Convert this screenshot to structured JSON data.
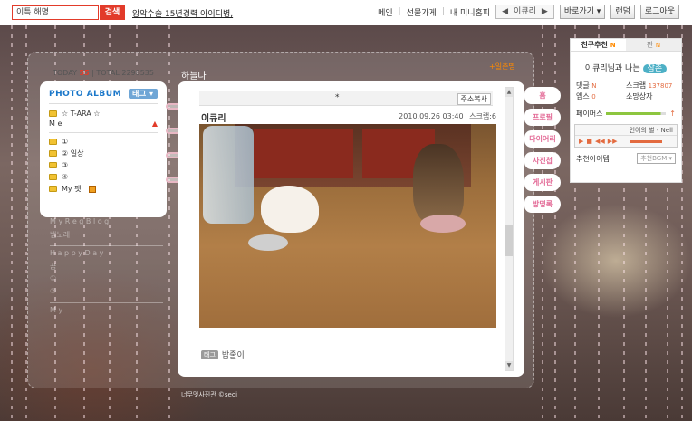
{
  "topbar": {
    "search_value": "이특 해명",
    "search_button": "검색",
    "promo_link": "앙악수술 15년경력 아이디병,",
    "nav": [
      "메인",
      "선물가게",
      "내 미니홈피"
    ],
    "qbox_left": "◀",
    "qbox_label": "이큐리",
    "qbox_right": "▶",
    "goto_button": "바로가기 ▾",
    "random_button": "랜덤",
    "logout_button": "로그아웃"
  },
  "header": {
    "today_label": "TODAY",
    "today_count": "55",
    "total_label": "TOTAL",
    "total_count": "2298535",
    "owner_name": "하늘나",
    "rss_label": "+일촌명"
  },
  "left": {
    "album_title": "PHOTO ALBUM",
    "tag_button": "태그 ▾",
    "top_folder": "☆ T-ARA ☆",
    "section1": "M e",
    "section1_arrow": "▲",
    "folders": [
      "①",
      "② 일상",
      "③",
      "④",
      "My 펫"
    ],
    "faded_rows": [
      "M y   R e g  B l o g",
      "뱀노래",
      "H a p p y  D a y",
      "꿈",
      "①",
      "②",
      "M y"
    ]
  },
  "main": {
    "header_star": "*",
    "list_button": "주소복사",
    "post_title": "이큐리",
    "post_date": "2010.09.26 03:40",
    "post_scrap": "스크랩:6",
    "tag_label": "태그",
    "tag_value": "밥줄이"
  },
  "rtabs": [
    "홈",
    "프로필",
    "다이어리",
    "사진첩",
    "게시판",
    "방명록"
  ],
  "widget": {
    "tab_friends": "친구추천",
    "tab_n1": "N",
    "tab_pan": "판",
    "tab_n2": "N",
    "relation_text": "이큐리님과 나는",
    "relation_pill": "잠촌",
    "stat1_label": "댓글",
    "stat1_value": "N",
    "stat2_label": "스크랩",
    "stat2_value": "137807",
    "stat3_label": "앱스",
    "stat3_value": "0",
    "stat4_label": "소망상자",
    "pace_label": "페이머스",
    "pace_arrow": "↑",
    "song": "인어의 별 - Nell",
    "recommend_label": "추천아이템",
    "recommend_select": "추천BGM ▾"
  },
  "footer": {
    "copyright": "너무멋사진관 ©seoi"
  }
}
